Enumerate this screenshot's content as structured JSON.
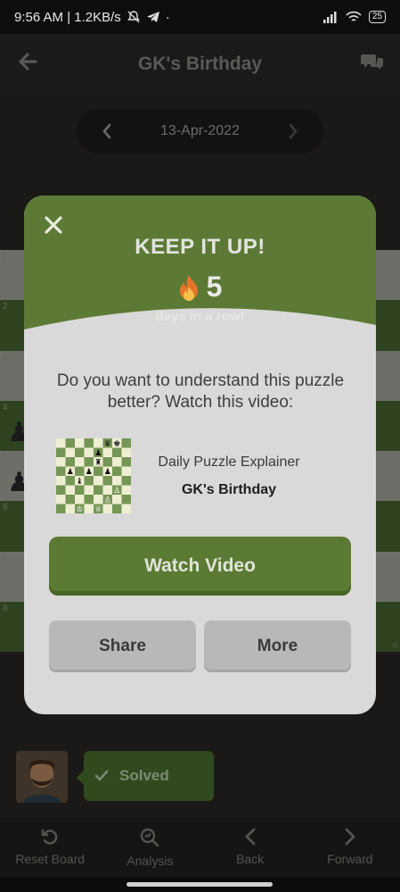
{
  "status_bar": {
    "time_speed": "9:56 AM | 1.2KB/s",
    "dot": "·",
    "battery": "25"
  },
  "header": {
    "title": "GK's Birthday",
    "back_icon": "arrow-left-icon",
    "chat_icon": "chat-bubbles-icon"
  },
  "date_nav": {
    "date": "13-Apr-2022",
    "prev_icon": "chevron-left-icon",
    "next_icon": "chevron-right-icon"
  },
  "board": {
    "rank_numbers": [
      "1",
      "2",
      "3",
      "4",
      "5",
      "6",
      "7",
      "8"
    ],
    "file_label": "a"
  },
  "solved_badge": {
    "label": "Solved"
  },
  "bottom_nav": {
    "items": [
      {
        "label": "Reset Board",
        "icon": "reset-icon"
      },
      {
        "label": "Analysis",
        "icon": "analysis-icon"
      },
      {
        "label": "Back",
        "icon": "chevron-left-icon"
      },
      {
        "label": "Forward",
        "icon": "chevron-right-icon"
      }
    ]
  },
  "modal": {
    "headline": "KEEP IT UP!",
    "streak_count": "5",
    "streak_label": "days in a row!",
    "question": "Do you want to understand this puzzle better? Watch this video:",
    "video_subtitle": "Daily Puzzle Explainer",
    "video_title": "GK's Birthday",
    "watch_label": "Watch Video",
    "share_label": "Share",
    "more_label": "More"
  },
  "colors": {
    "accent_green": "#5b7a33",
    "modal_bg": "#d9d9d9",
    "header_green": "#5c7a35"
  }
}
